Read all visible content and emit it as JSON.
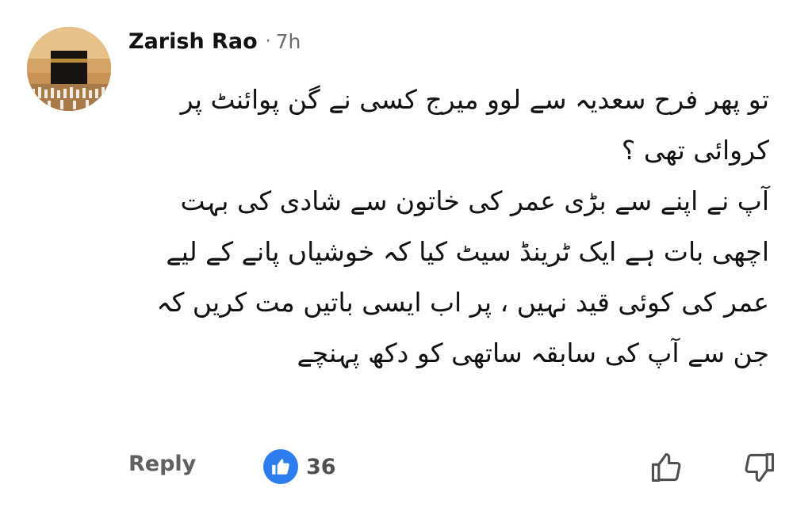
{
  "comment": {
    "author": "Zarish Rao",
    "separator": "·",
    "time": "7h",
    "paragraphs": [
      "تو پھر فرح سعدیہ سے لوو میرج کسی نے گن پوائنٹ پر کروائی تھی ؟",
      "آپ نے اپنے سے بڑی عمر کی خاتون سے شادی کی بہت اچھی بات ہے ایک ٹرینڈ سیٹ کیا کہ خوشیاں پانے کے لیے عمر کی کوئی قید نہیں ، پر اب ایسی باتیں مت کریں کہ جن سے آپ کی سابقہ ساتھی کو دکھ پہنچے"
    ]
  },
  "actions": {
    "reply_label": "Reply",
    "like_count": "36"
  },
  "colors": {
    "like_blue": "#2d7cf0",
    "muted_text": "#6b6b6b"
  },
  "icons": {
    "avatar": "kaaba-photo-avatar",
    "reaction": "thumbs-up-icon",
    "like": "thumbs-up-outline-icon",
    "dislike": "thumbs-down-outline-icon"
  }
}
